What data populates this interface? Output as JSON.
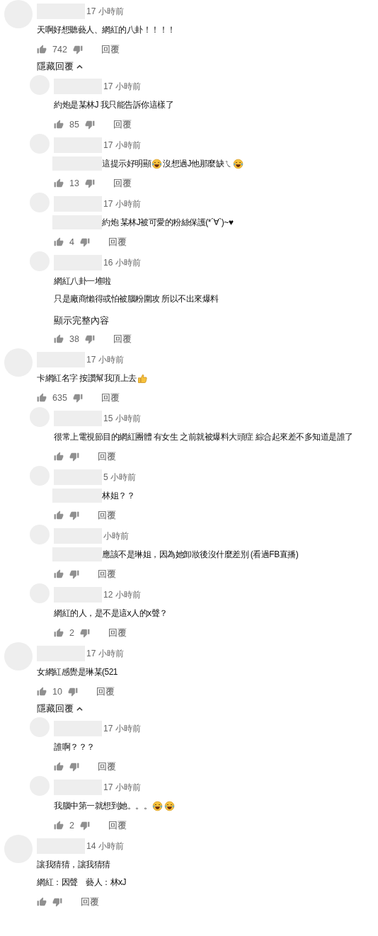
{
  "comments": [
    {
      "kind": "top",
      "time": "17 小時前",
      "lines": [
        [
          {
            "text": "天啊好想聽藝人、網紅的八卦！！！！"
          }
        ]
      ],
      "likes": "742",
      "reply": "回覆",
      "hide_replies": "隱藏回覆",
      "children": [
        {
          "kind": "reply",
          "time": "17 小時前",
          "lines": [
            [
              {
                "text": "約炮是某林J 我只能告訴你這樣了"
              }
            ]
          ],
          "likes": "85",
          "reply": "回覆"
        },
        {
          "kind": "reply",
          "time": "17 小時前",
          "body_redacted": true,
          "lines": [
            [
              {
                "text": "這提示好明顯"
              },
              {
                "kind": "laugh-emoji"
              },
              {
                "text": "沒想過J他那麼缺ㄟ"
              },
              {
                "kind": "laugh-emoji"
              }
            ]
          ],
          "likes": "13",
          "reply": "回覆"
        },
        {
          "kind": "reply",
          "time": "17 小時前",
          "body_redacted": true,
          "lines": [
            [
              {
                "text": "約炮 某林J被可愛的粉絲保護(*´∀`)~♥"
              }
            ]
          ],
          "likes": "4",
          "reply": "回覆"
        },
        {
          "kind": "reply",
          "time": "16 小時前",
          "lines": [
            [
              {
                "text": "網紅八卦一堆啦"
              }
            ],
            [
              {
                "text": "只是廠商懶得或怕被腦粉圍攻 所以不出來爆料"
              }
            ]
          ],
          "read_more": "顯示完整內容",
          "likes": "38",
          "reply": "回覆"
        }
      ]
    },
    {
      "kind": "top",
      "time": "17 小時前",
      "lines": [
        [
          {
            "text": "卡網紅名字 按讚幫我頂上去"
          },
          {
            "kind": "thumb-emoji"
          }
        ]
      ],
      "likes": "635",
      "reply": "回覆",
      "children": [
        {
          "kind": "reply",
          "time": "15 小時前",
          "lines": [
            [
              {
                "text": "很常上電視節目的網紅團體 有女生 之前就被爆料大頭症 綜合起來差不多知道是誰了"
              }
            ]
          ],
          "reply": "回覆"
        },
        {
          "kind": "reply",
          "time": "5 小時前",
          "body_redacted": true,
          "lines": [
            [
              {
                "text": "林姐？？"
              }
            ]
          ],
          "reply": "回覆"
        },
        {
          "kind": "reply",
          "time": "小時前",
          "body_redacted": true,
          "lines": [
            [
              {
                "text": "應該不是琳姐，因為她卸妝後沒什麼差別 (看過FB直播)"
              }
            ]
          ],
          "reply": "回覆"
        },
        {
          "kind": "reply",
          "time": "12 小時前",
          "lines": [
            [
              {
                "text": "網紅的人，是不是這x人的x聲？"
              }
            ]
          ],
          "likes": "2",
          "reply": "回覆"
        }
      ]
    },
    {
      "kind": "top",
      "time": "17 小時前",
      "lines": [
        [
          {
            "text": "女網紅感覺是琳某(521"
          }
        ]
      ],
      "likes": "10",
      "reply": "回覆",
      "hide_replies": "隱藏回覆",
      "children": [
        {
          "kind": "reply",
          "time": "17 小時前",
          "lines": [
            [
              {
                "text": "誰啊？？？"
              }
            ]
          ],
          "reply": "回覆"
        },
        {
          "kind": "reply",
          "time": "17 小時前",
          "lines": [
            [
              {
                "text": "我腦中第一就想到她。。。"
              },
              {
                "kind": "laugh-emoji"
              },
              {
                "kind": "laugh-emoji"
              }
            ]
          ],
          "likes": "2",
          "reply": "回覆"
        }
      ]
    },
    {
      "kind": "top",
      "time": "14 小時前",
      "lines": [
        [
          {
            "text": "讓我猜猜，讓我猜猜"
          }
        ],
        [
          {
            "text": "網紅：因聲　藝人：林xJ"
          }
        ]
      ],
      "reply": "回覆"
    }
  ]
}
